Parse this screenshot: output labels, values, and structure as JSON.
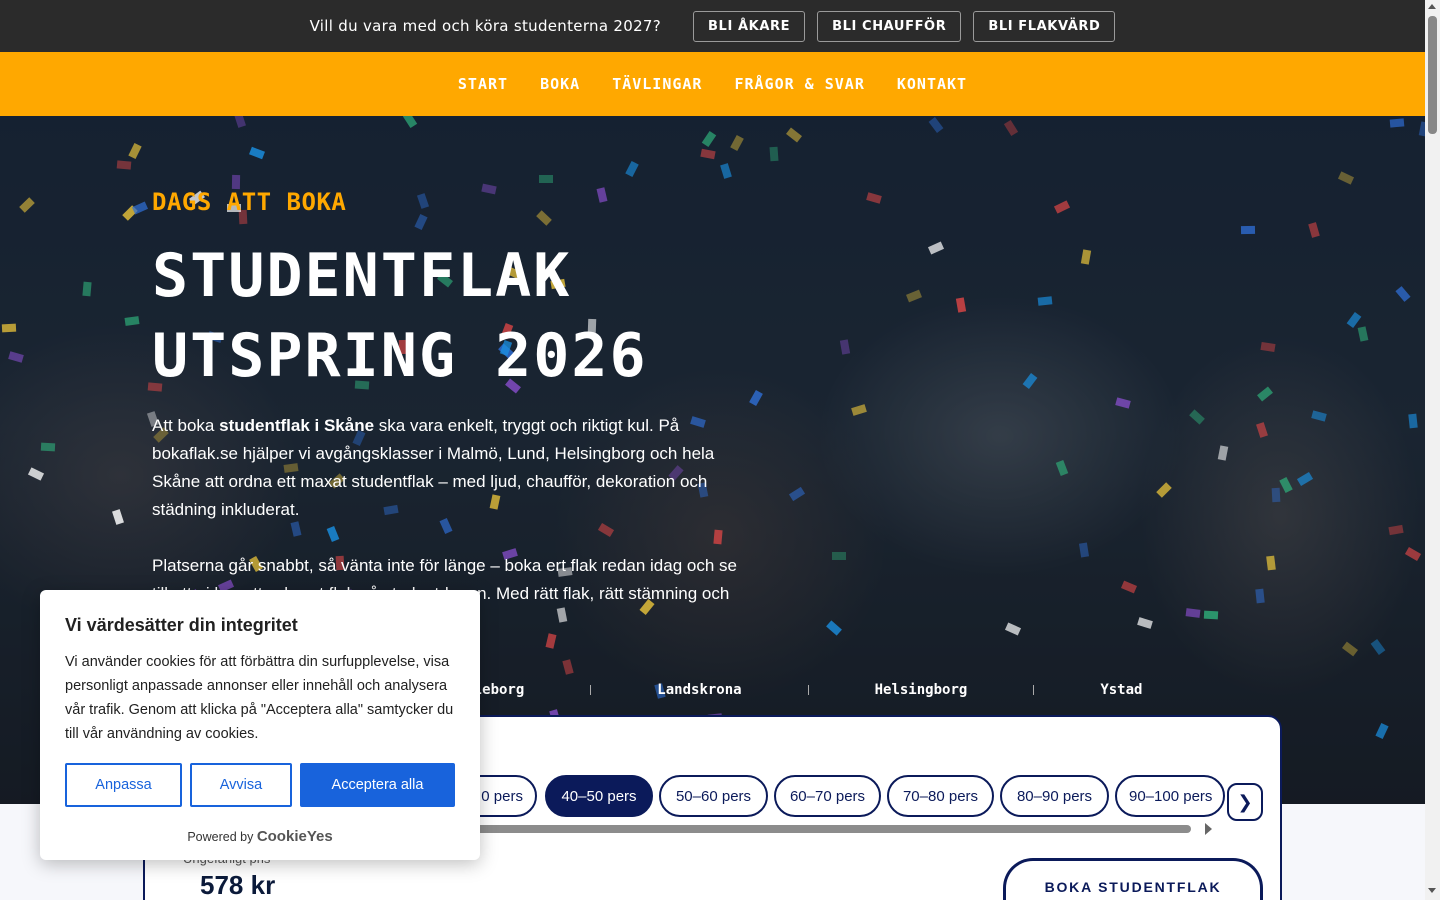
{
  "topbar": {
    "text": "Vill du vara med och köra studenterna 2027?",
    "buttons": [
      "BLI ÅKARE",
      "BLI CHAUFFÖR",
      "BLI FLAKVÄRD"
    ]
  },
  "nav": {
    "items": [
      "START",
      "BOKA",
      "TÄVLINGAR",
      "FRÅGOR & SVAR",
      "KONTAKT"
    ]
  },
  "hero": {
    "kicker": "DAGS ATT BOKA",
    "title": "STUDENTFLAK UTSPRING 2026",
    "p1_prefix": "Att boka ",
    "p1_bold": "studentflak i Skåne",
    "p1_suffix": " ska vara enkelt, tryggt och riktigt kul. På bokaflak.se hjälper vi avgångsklasser i Malmö, Lund, Helsingborg och hela Skåne att ordna ett maxat studentflak – med ljud, chaufför, dekoration och städning inkluderat.",
    "p2": "Platserna går snabbt, så vänta inte för länge – boka ert flak redan idag och se till att ni har ett schysst flak på studentdagen. Med rätt flak, rätt stämning och rätt"
  },
  "cities": [
    "Trelleborg",
    "Landskrona",
    "Helsingborg",
    "Ystad"
  ],
  "booking": {
    "size_options": [
      "30–40 pers",
      "40–50 pers",
      "50–60 pers",
      "60–70 pers",
      "70–80 pers",
      "80–90 pers",
      "90–100 pers"
    ],
    "visible_first_option": "0 pers",
    "selected": "40–50 pers",
    "price_label": "Ungefärligt pris",
    "price_value": "578 kr",
    "book_button": "BOKA STUDENTFLAK"
  },
  "cookie": {
    "title": "Vi värdesätter din integritet",
    "text": "Vi använder cookies för att förbättra din surfupplevelse, visa personligt anpassade annonser eller innehåll och analysera vår trafik. Genom att klicka på \"Acceptera alla\" samtycker du till vår användning av cookies.",
    "btn_customize": "Anpassa",
    "btn_reject": "Avvisa",
    "btn_accept": "Acceptera alla",
    "powered_by": "Powered by",
    "brand": "CookieYes"
  },
  "colors": {
    "accent": "#ffa800",
    "navy": "#0b1a5a",
    "cookie_blue": "#1863dc",
    "topbar": "#2b2b2b"
  }
}
